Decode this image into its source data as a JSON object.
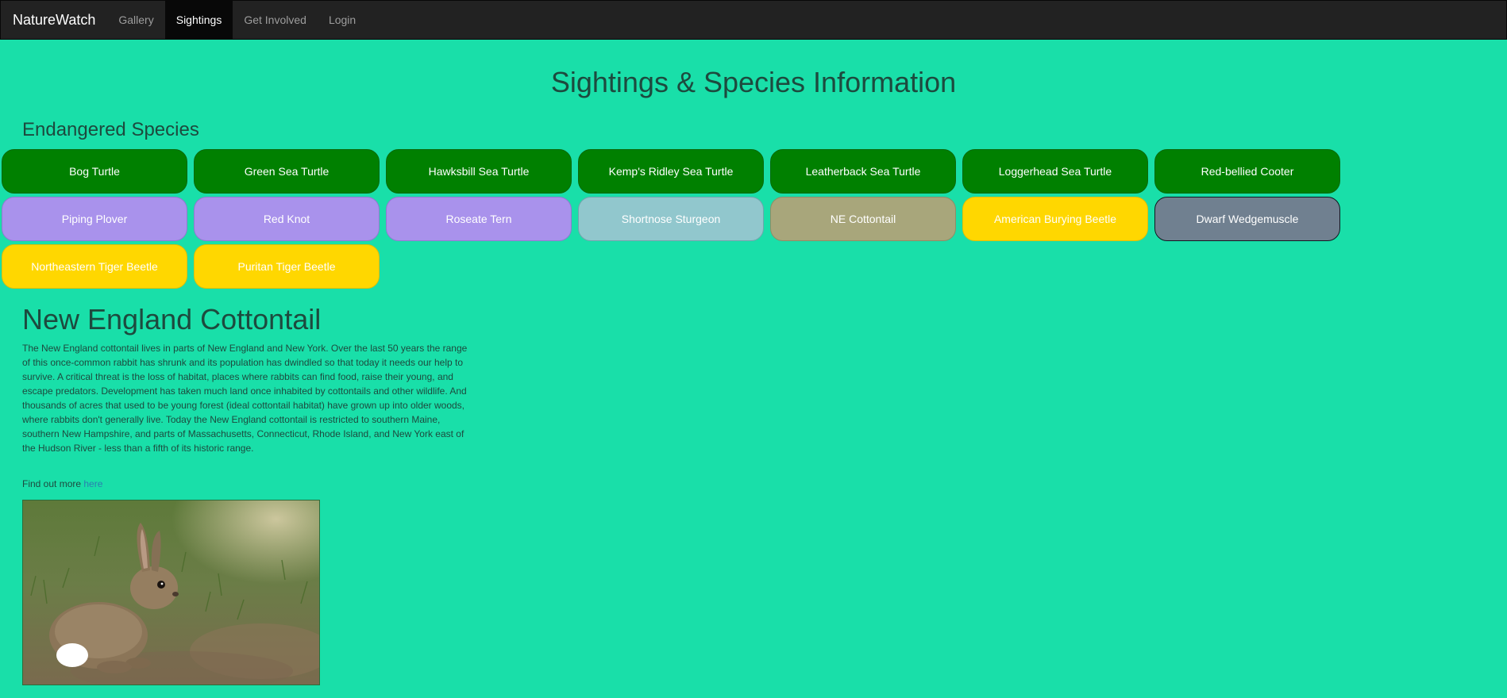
{
  "nav": {
    "brand": "NatureWatch",
    "links": [
      "Gallery",
      "Sightings",
      "Get Involved",
      "Login"
    ],
    "active": "Sightings"
  },
  "page_title": "Sightings & Species Information",
  "section_title": "Endangered Species",
  "species": [
    {
      "label": "Bog Turtle",
      "group": "turtle",
      "color": "#008000"
    },
    {
      "label": "Green Sea Turtle",
      "group": "turtle",
      "color": "#008000"
    },
    {
      "label": "Hawksbill Sea Turtle",
      "group": "turtle",
      "color": "#008000"
    },
    {
      "label": "Kemp's Ridley Sea Turtle",
      "group": "turtle",
      "color": "#008000"
    },
    {
      "label": "Leatherback Sea Turtle",
      "group": "turtle",
      "color": "#008000"
    },
    {
      "label": "Loggerhead Sea Turtle",
      "group": "turtle",
      "color": "#008000"
    },
    {
      "label": "Red-bellied Cooter",
      "group": "turtle",
      "color": "#008000"
    },
    {
      "label": "Piping Plover",
      "group": "bird",
      "color": "#a992ec"
    },
    {
      "label": "Red Knot",
      "group": "bird",
      "color": "#a992ec"
    },
    {
      "label": "Roseate Tern",
      "group": "bird",
      "color": "#a992ec"
    },
    {
      "label": "Shortnose Sturgeon",
      "group": "fish",
      "color": "#91c7cd"
    },
    {
      "label": "NE Cottontail",
      "group": "mammal",
      "color": "#a8a67b"
    },
    {
      "label": "American Burying Beetle",
      "group": "insect",
      "color": "#ffd700"
    },
    {
      "label": "Dwarf Wedgemuscle",
      "group": "mussel",
      "color": "#708090"
    },
    {
      "label": "Northeastern Tiger Beetle",
      "group": "insect",
      "color": "#ffd700"
    },
    {
      "label": "Puritan Tiger Beetle",
      "group": "insect",
      "color": "#ffd700"
    }
  ],
  "detail": {
    "title": "New England Cottontail",
    "description": "The New England cottontail lives in parts of New England and New York. Over the last 50 years the range of this once-common rabbit has shrunk and its population has dwindled so that today it needs our help to survive. A critical threat is the loss of habitat, places where rabbits can find food, raise their young, and escape predators. Development has taken much land once inhabited by cottontails and other wildlife. And thousands of acres that used to be young forest (ideal cottontail habitat) have grown up into older woods, where rabbits don't generally live. Today the New England cottontail is restricted to southern Maine, southern New Hampshire, and parts of Massachusetts, Connecticut, Rhode Island, and New York east of the Hudson River - less than a fifth of its historic range.",
    "find_more_prefix": "Find out more ",
    "find_more_link": "here"
  },
  "colors": {
    "background": "#19dfa9",
    "navbar": "#222222",
    "heading": "#1d4a3e",
    "link": "#2a7fb0"
  }
}
